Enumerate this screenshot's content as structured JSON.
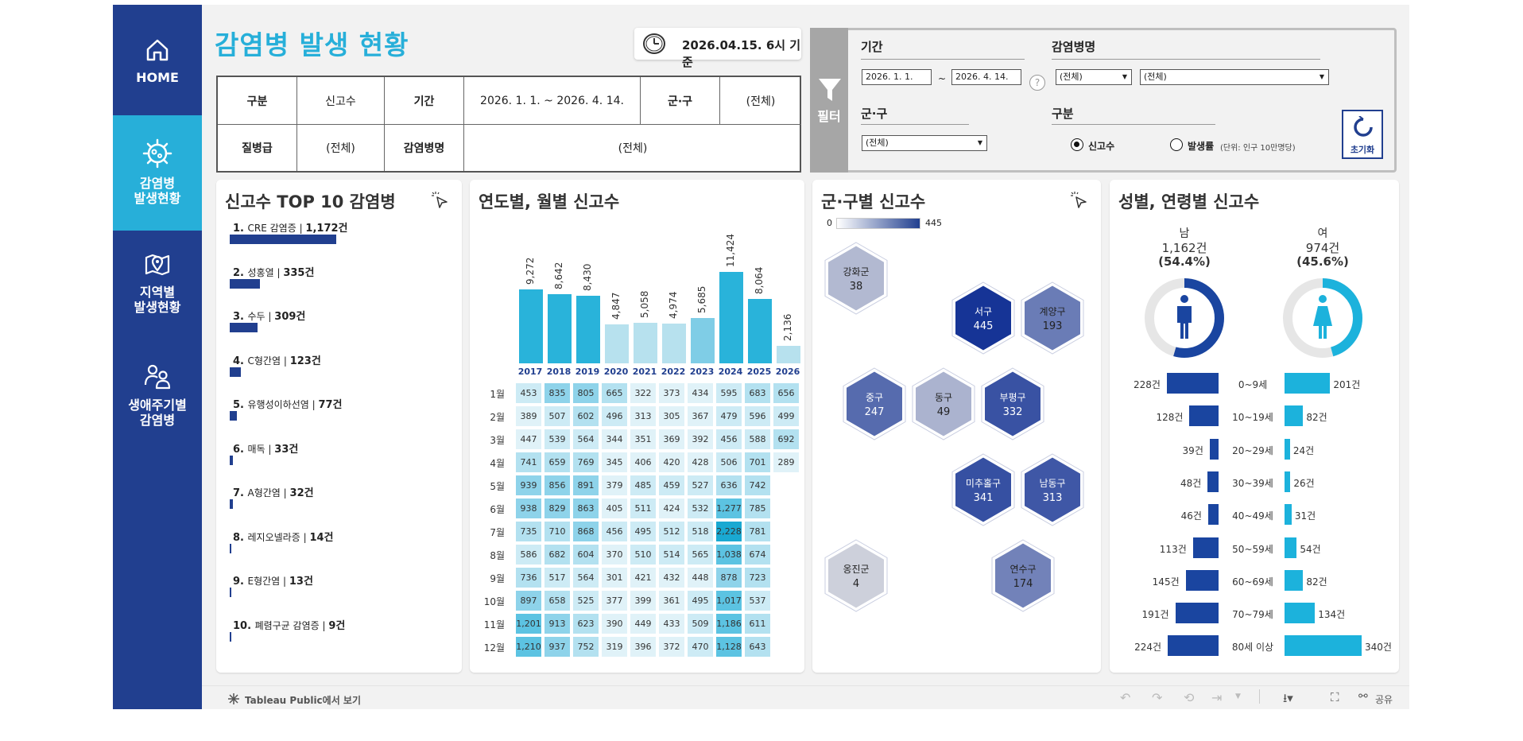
{
  "sidebar": {
    "items": [
      {
        "label": "HOME",
        "label2": "",
        "icon": "home-icon",
        "active": false
      },
      {
        "label": "감염병",
        "label2": "발생현황",
        "icon": "virus-icon",
        "active": true
      },
      {
        "label": "지역별",
        "label2": "발생현황",
        "icon": "map-pin-icon",
        "active": false
      },
      {
        "label": "생애주기별",
        "label2": "감염병",
        "icon": "people-icon",
        "active": false
      }
    ]
  },
  "header": {
    "title": "감염병 발생 현황",
    "date_text": "2026.04.15. 6시 기준"
  },
  "info_table": {
    "h_category": "구분",
    "v_category": "신고수",
    "h_period": "기간",
    "v_period": "2026. 1. 1. ~ 2026. 4. 14.",
    "h_district": "군·구",
    "v_district": "(전체)",
    "h_grade": "질병급",
    "v_grade": "(전체)",
    "h_disease": "감염병명",
    "v_disease": "(전체)"
  },
  "filter": {
    "tab_label": "필터",
    "period_label": "기간",
    "start_date": "2026. 1. 1.",
    "tilde": "~",
    "end_date": "2026. 4. 14.",
    "help": "?",
    "disease_label": "감염병명",
    "disease_sel1": "(전체)",
    "disease_sel2": "(전체)",
    "district_label": "군·구",
    "district_sel": "(전체)",
    "category_label": "구분",
    "radio1": "신고수",
    "radio2": "발생률",
    "radio2_note": "(단위: 인구 10만명당)",
    "reset": "초기화"
  },
  "top10": {
    "title": "신고수 TOP 10 감염병",
    "items": [
      {
        "rank": "1.",
        "name": "CRE 감염증",
        "count": "1,172건",
        "value": 1172
      },
      {
        "rank": "2.",
        "name": "성홍열",
        "count": "335건",
        "value": 335
      },
      {
        "rank": "3.",
        "name": "수두",
        "count": "309건",
        "value": 309
      },
      {
        "rank": "4.",
        "name": "C형간염",
        "count": "123건",
        "value": 123
      },
      {
        "rank": "5.",
        "name": "유행성이하선염",
        "count": "77건",
        "value": 77
      },
      {
        "rank": "6.",
        "name": "매독",
        "count": "33건",
        "value": 33
      },
      {
        "rank": "7.",
        "name": "A형간염",
        "count": "32건",
        "value": 32
      },
      {
        "rank": "8.",
        "name": "레지오넬라증",
        "count": "14건",
        "value": 14
      },
      {
        "rank": "9.",
        "name": "E형간염",
        "count": "13건",
        "value": 13
      },
      {
        "rank": "10.",
        "name": "폐렴구균 감염증",
        "count": "9건",
        "value": 9
      }
    ]
  },
  "yearly": {
    "title": "연도별, 월별 신고수",
    "years": [
      "2017",
      "2018",
      "2019",
      "2020",
      "2021",
      "2022",
      "2023",
      "2024",
      "2025",
      "2026"
    ],
    "totals": [
      9272,
      8642,
      8430,
      4847,
      5058,
      4974,
      5685,
      11424,
      8064,
      2136
    ],
    "totals_text": [
      "9,272",
      "8,642",
      "8,430",
      "4,847",
      "5,058",
      "4,974",
      "5,685",
      "11,424",
      "8,064",
      "2,136"
    ],
    "months": [
      "1월",
      "2월",
      "3월",
      "4월",
      "5월",
      "6월",
      "7월",
      "8월",
      "9월",
      "10월",
      "11월",
      "12월"
    ],
    "heatmap": [
      [
        "453",
        "835",
        "805",
        "665",
        "322",
        "373",
        "434",
        "595",
        "683",
        "656"
      ],
      [
        "389",
        "507",
        "602",
        "496",
        "313",
        "305",
        "367",
        "479",
        "596",
        "499"
      ],
      [
        "447",
        "539",
        "564",
        "344",
        "351",
        "369",
        "392",
        "456",
        "588",
        "692"
      ],
      [
        "741",
        "659",
        "769",
        "345",
        "406",
        "420",
        "428",
        "506",
        "701",
        "289"
      ],
      [
        "939",
        "856",
        "891",
        "379",
        "485",
        "459",
        "527",
        "636",
        "742",
        ""
      ],
      [
        "938",
        "829",
        "863",
        "405",
        "511",
        "424",
        "532",
        "1,277",
        "785",
        ""
      ],
      [
        "735",
        "710",
        "868",
        "456",
        "495",
        "512",
        "518",
        "2,228",
        "781",
        ""
      ],
      [
        "586",
        "682",
        "604",
        "370",
        "510",
        "514",
        "565",
        "1,038",
        "674",
        ""
      ],
      [
        "736",
        "517",
        "564",
        "301",
        "421",
        "432",
        "448",
        "878",
        "723",
        ""
      ],
      [
        "897",
        "658",
        "525",
        "377",
        "399",
        "361",
        "495",
        "1,017",
        "537",
        ""
      ],
      [
        "1,201",
        "913",
        "623",
        "390",
        "449",
        "433",
        "509",
        "1,186",
        "611",
        ""
      ],
      [
        "1,210",
        "937",
        "752",
        "319",
        "396",
        "372",
        "470",
        "1,128",
        "643",
        ""
      ]
    ]
  },
  "district": {
    "title": "군·구별 신고수",
    "legend_min": "0",
    "legend_max": "445",
    "items": [
      {
        "name": "강화군",
        "value": 38
      },
      {
        "name": "서구",
        "value": 445
      },
      {
        "name": "계양구",
        "value": 193
      },
      {
        "name": "중구",
        "value": 247
      },
      {
        "name": "동구",
        "value": 49
      },
      {
        "name": "부평구",
        "value": 332
      },
      {
        "name": "미추홀구",
        "value": 341
      },
      {
        "name": "남동구",
        "value": 313
      },
      {
        "name": "옹진군",
        "value": 4
      },
      {
        "name": "연수구",
        "value": 174
      }
    ]
  },
  "gender_age": {
    "title": "성별, 연령별 신고수",
    "male_label": "남",
    "male_count": "1,162건",
    "male_pct": "(54.4%)",
    "male_share": 0.544,
    "female_label": "여",
    "female_count": "974건",
    "female_pct": "(45.6%)",
    "female_share": 0.456,
    "ages": [
      "0~9세",
      "10~19세",
      "20~29세",
      "30~39세",
      "40~49세",
      "50~59세",
      "60~69세",
      "70~79세",
      "80세 이상"
    ],
    "male": [
      228,
      128,
      39,
      48,
      46,
      113,
      145,
      191,
      224
    ],
    "male_text": [
      "228건",
      "128건",
      "39건",
      "48건",
      "46건",
      "113건",
      "145건",
      "191건",
      "224건"
    ],
    "female": [
      201,
      82,
      24,
      26,
      31,
      54,
      82,
      134,
      340
    ],
    "female_text": [
      "201건",
      "82건",
      "24건",
      "26건",
      "31건",
      "54건",
      "82건",
      "134건",
      "340건"
    ]
  },
  "footer": {
    "tableau": "Tableau Public에서 보기",
    "share": "공유"
  },
  "colors": {
    "navy": "#213f8f",
    "cyan": "#27afd9",
    "male": "#1a45a0",
    "female": "#1cb2dc"
  }
}
